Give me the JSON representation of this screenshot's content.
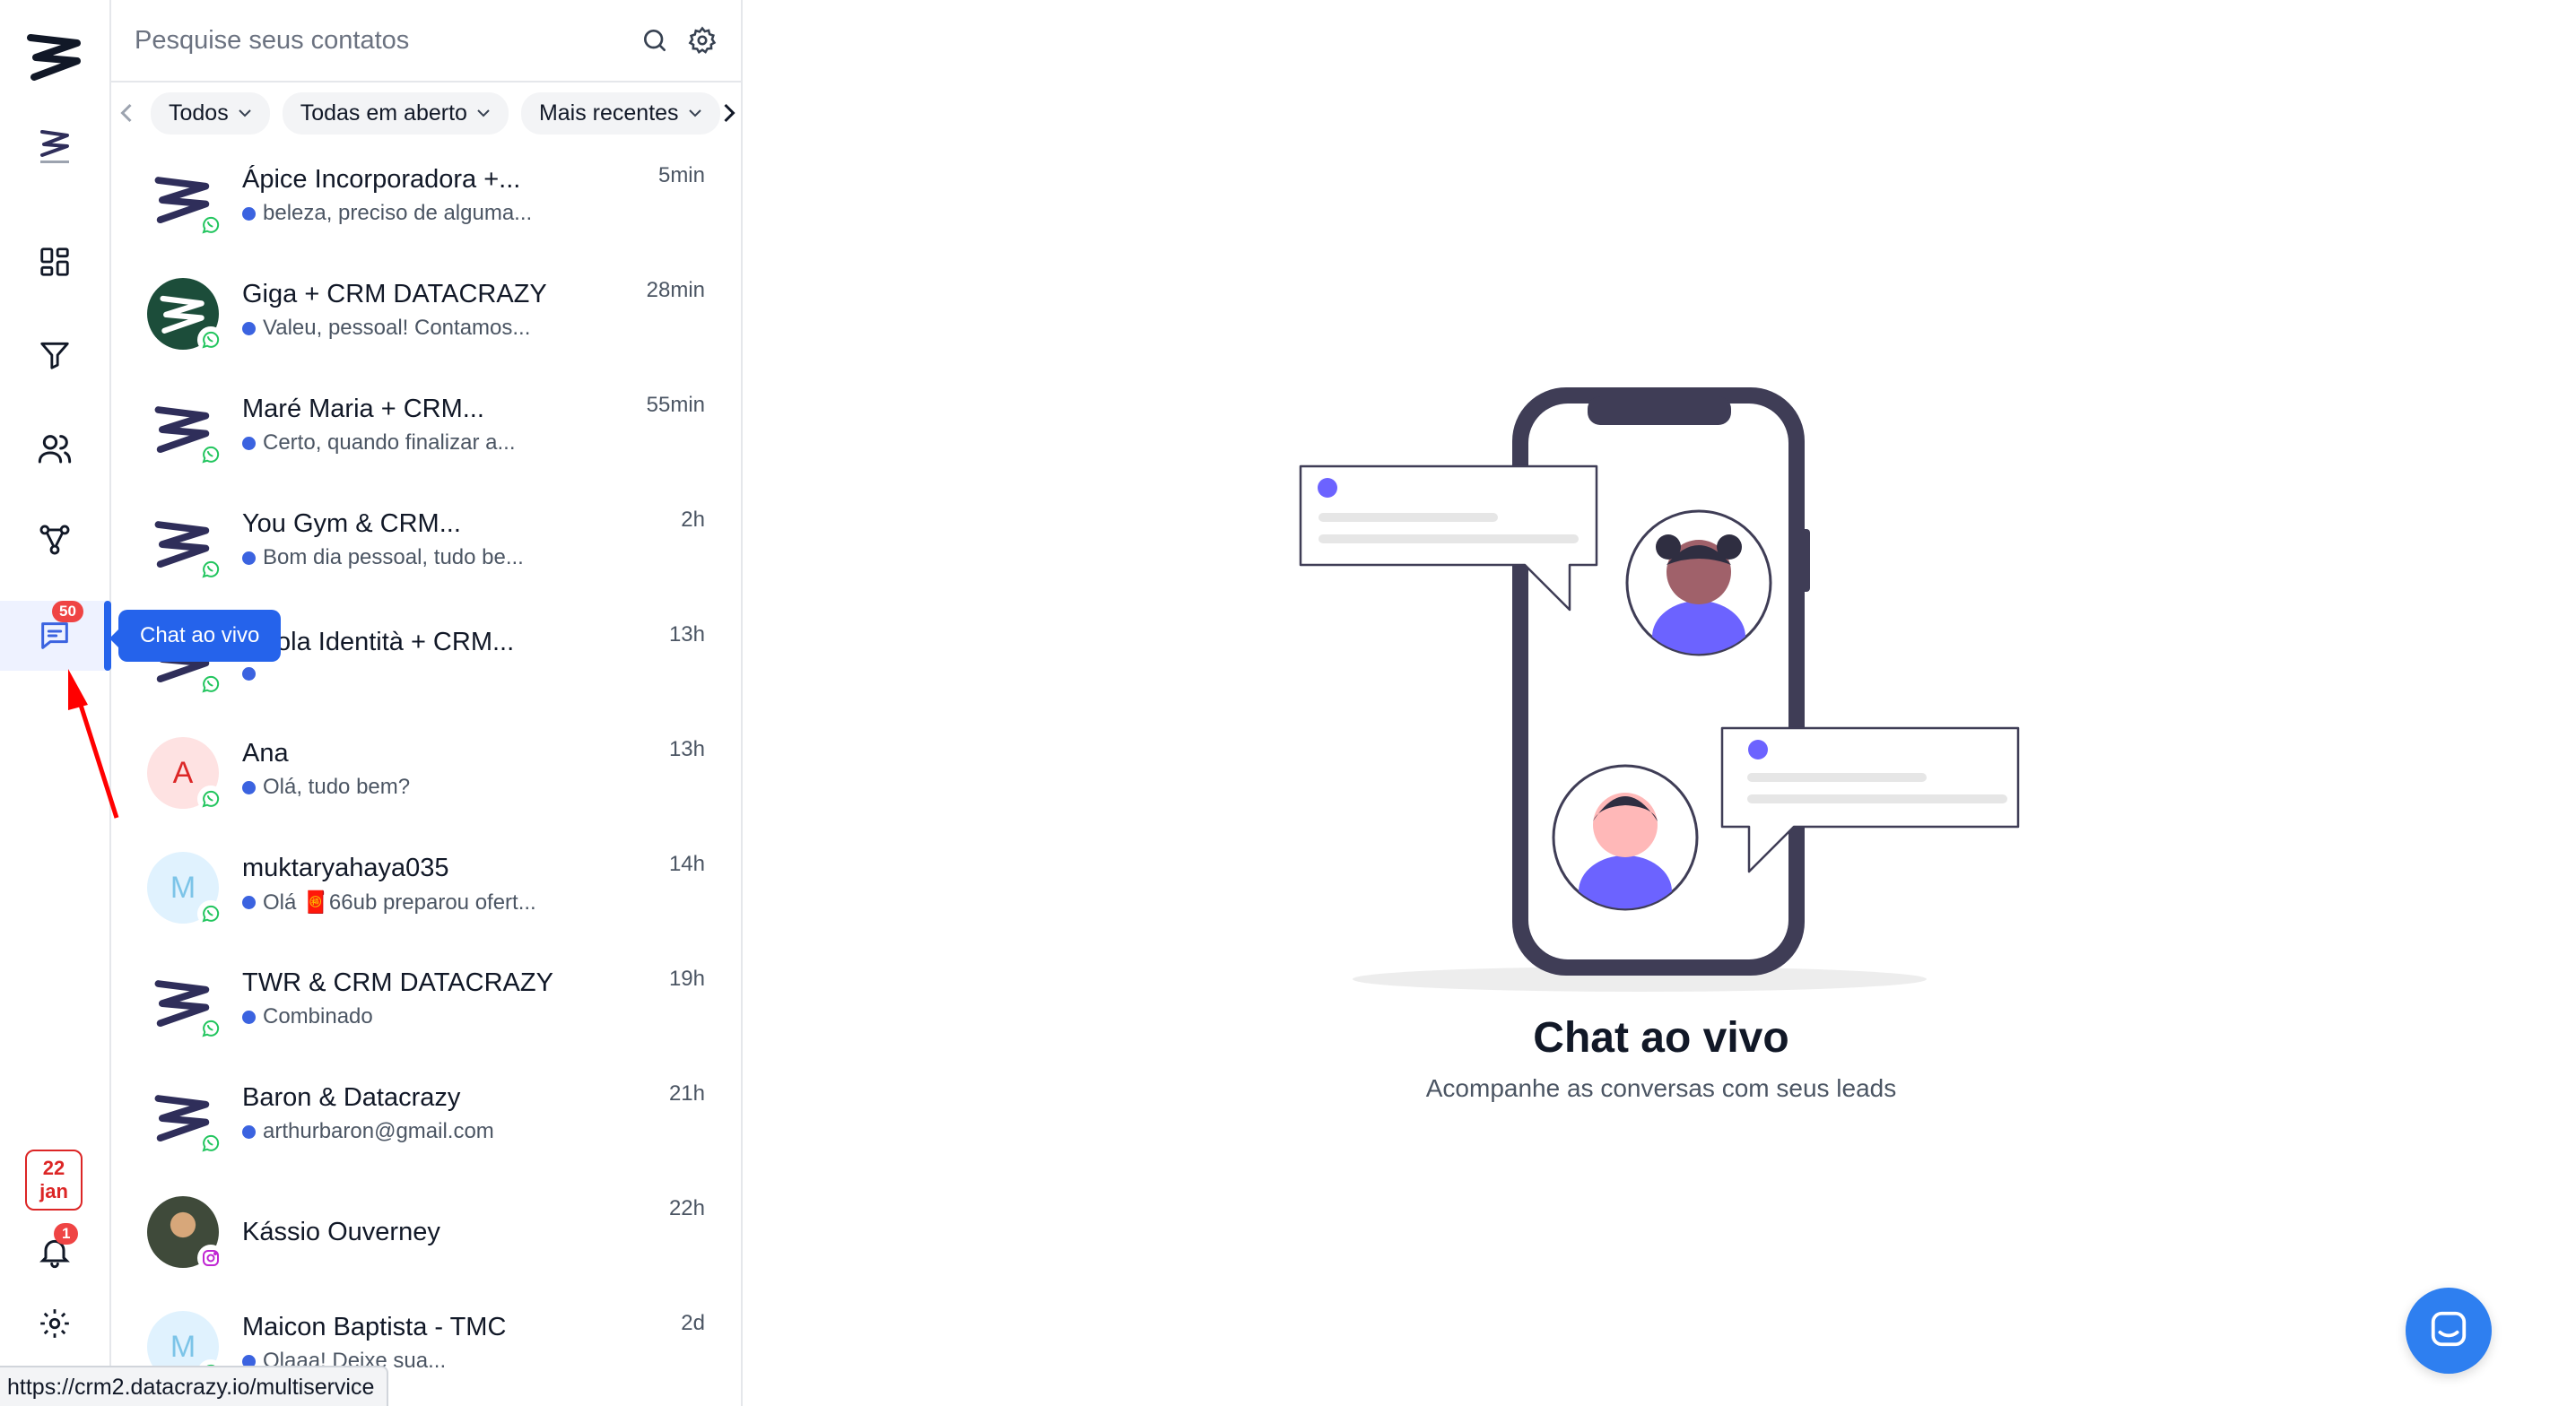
{
  "sidebar": {
    "tooltip": "Chat ao vivo",
    "chat_badge": "50",
    "date_day": "22",
    "date_month": "jan",
    "notif_badge": "1",
    "items": [
      {
        "icon": "brand-logo-icon"
      },
      {
        "icon": "company-logo-icon"
      },
      {
        "icon": "dashboard-icon"
      },
      {
        "icon": "funnel-icon"
      },
      {
        "icon": "users-icon"
      },
      {
        "icon": "flow-icon"
      },
      {
        "icon": "chat-icon"
      },
      {
        "icon": "bell-icon"
      },
      {
        "icon": "gear-icon"
      }
    ]
  },
  "search": {
    "placeholder": "Pesquise seus contatos"
  },
  "filters": [
    {
      "label": "Todos"
    },
    {
      "label": "Todas em aberto"
    },
    {
      "label": "Mais recentes"
    }
  ],
  "contacts": [
    {
      "name": "Ápice Incorporadora +...",
      "preview": "beleza, preciso de alguma...",
      "time": "5min",
      "avatar": "logo",
      "source": "whatsapp"
    },
    {
      "name": "Giga + CRM DATACRAZY",
      "preview": "Valeu, pessoal! Contamos...",
      "time": "28min",
      "avatar": "green",
      "source": "whatsapp"
    },
    {
      "name": "Maré Maria + CRM...",
      "preview": "Certo, quando finalizar a...",
      "time": "55min",
      "avatar": "logo",
      "source": "whatsapp"
    },
    {
      "name": "You Gym & CRM...",
      "preview": "Bom dia pessoal, tudo be...",
      "time": "2h",
      "avatar": "logo",
      "source": "whatsapp"
    },
    {
      "name": "ola Identità + CRM...",
      "preview": "",
      "time": "13h",
      "avatar": "logo",
      "source": "whatsapp"
    },
    {
      "name": "Ana",
      "preview": "Olá, tudo bem?",
      "time": "13h",
      "avatar": "A",
      "source": "whatsapp"
    },
    {
      "name": "muktaryahaya035",
      "preview": "Olá 🧧66ub preparou ofert...",
      "time": "14h",
      "avatar": "M",
      "source": "whatsapp"
    },
    {
      "name": "TWR & CRM DATACRAZY",
      "preview": "Combinado",
      "time": "19h",
      "avatar": "logo",
      "source": "whatsapp"
    },
    {
      "name": "Baron & Datacrazy",
      "preview": "arthurbaron@gmail.com",
      "time": "21h",
      "avatar": "logo",
      "source": "whatsapp"
    },
    {
      "name": "Kássio Ouverney",
      "preview": "",
      "time": "22h",
      "avatar": "photo",
      "source": "instagram"
    },
    {
      "name": "Maicon Baptista - TMC",
      "preview": "Olaaa! Deixe sua...",
      "time": "2d",
      "avatar": "M",
      "source": "whatsapp"
    }
  ],
  "main": {
    "title": "Chat ao vivo",
    "subtitle": "Acompanhe as conversas com seus leads"
  },
  "status_url": "https://crm2.datacrazy.io/multiservice",
  "colors": {
    "accent": "#2563eb",
    "badge": "#ef4444",
    "illustration_purple": "#6c63ff",
    "logo_navy": "#2f2e5a"
  }
}
